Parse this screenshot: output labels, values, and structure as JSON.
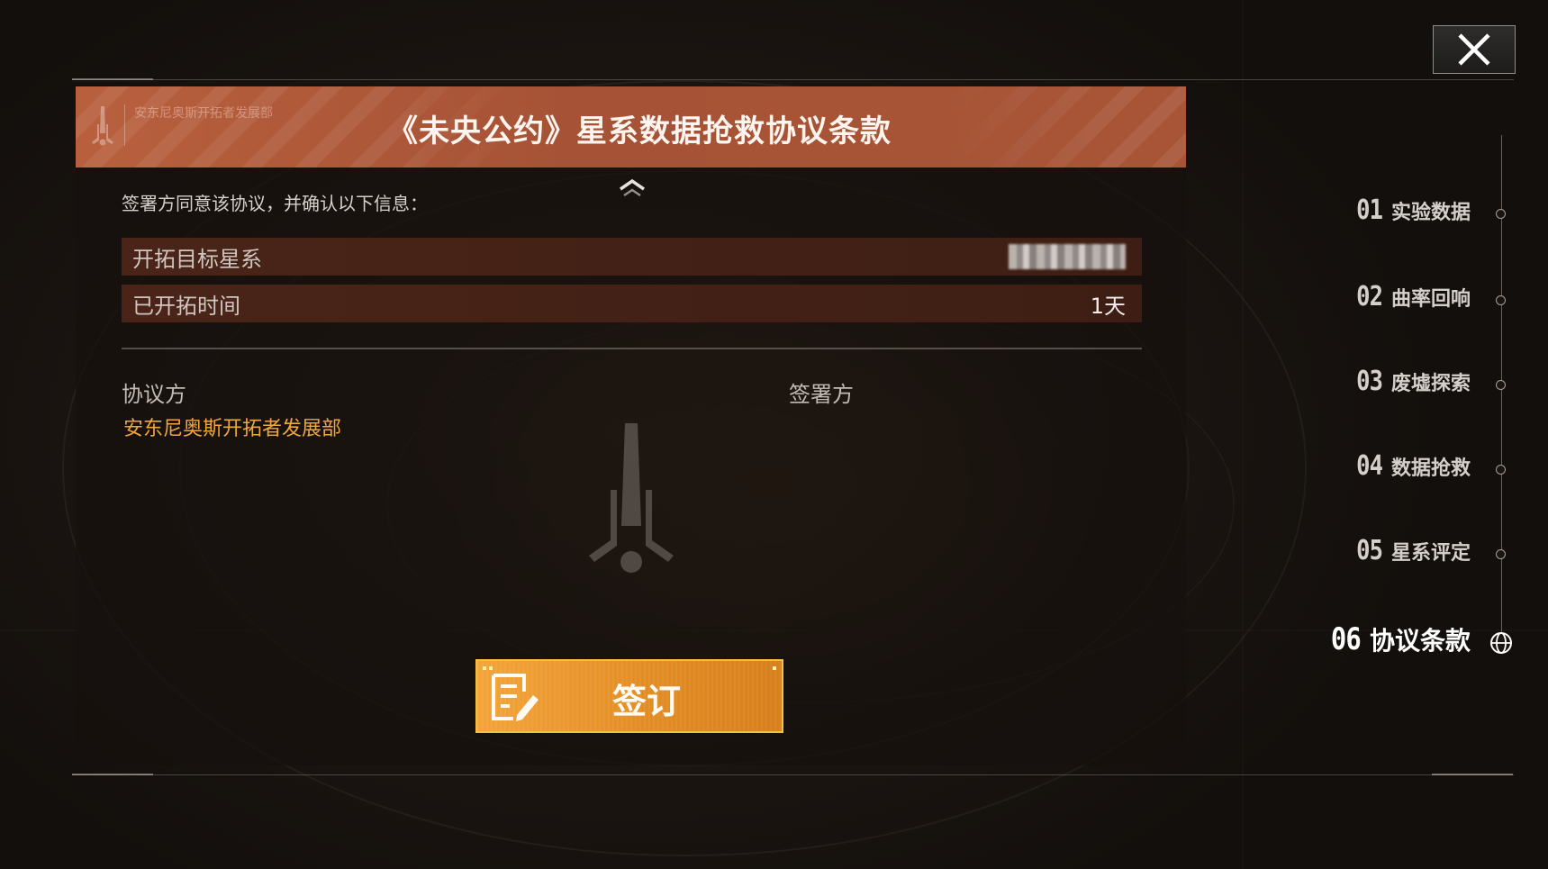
{
  "window": {
    "close_icon": "close-x-icon"
  },
  "panel": {
    "org_name": "安东尼奥斯开拓者发展部",
    "title": "《未央公约》星系数据抢救协议条款",
    "intro": "签署方同意该协议，并确认以下信息：",
    "rows": [
      {
        "label": "开拓目标星系",
        "value": ""
      },
      {
        "label": "已开拓时间",
        "value": "1天"
      }
    ],
    "party_a_label": "协议方",
    "party_a_name": "安东尼奥斯开拓者发展部",
    "party_b_label": "签署方",
    "sign_button_label": "签订"
  },
  "steps": [
    {
      "num": "01",
      "name": "实验数据"
    },
    {
      "num": "02",
      "name": "曲率回响"
    },
    {
      "num": "03",
      "name": "废墟探索"
    },
    {
      "num": "04",
      "name": "数据抢救"
    },
    {
      "num": "05",
      "name": "星系评定"
    },
    {
      "num": "06",
      "name": "协议条款",
      "active": true
    }
  ],
  "colors": {
    "header": "#b05a3a",
    "accent_orange": "#f0a63a",
    "button": "#e8952b"
  }
}
